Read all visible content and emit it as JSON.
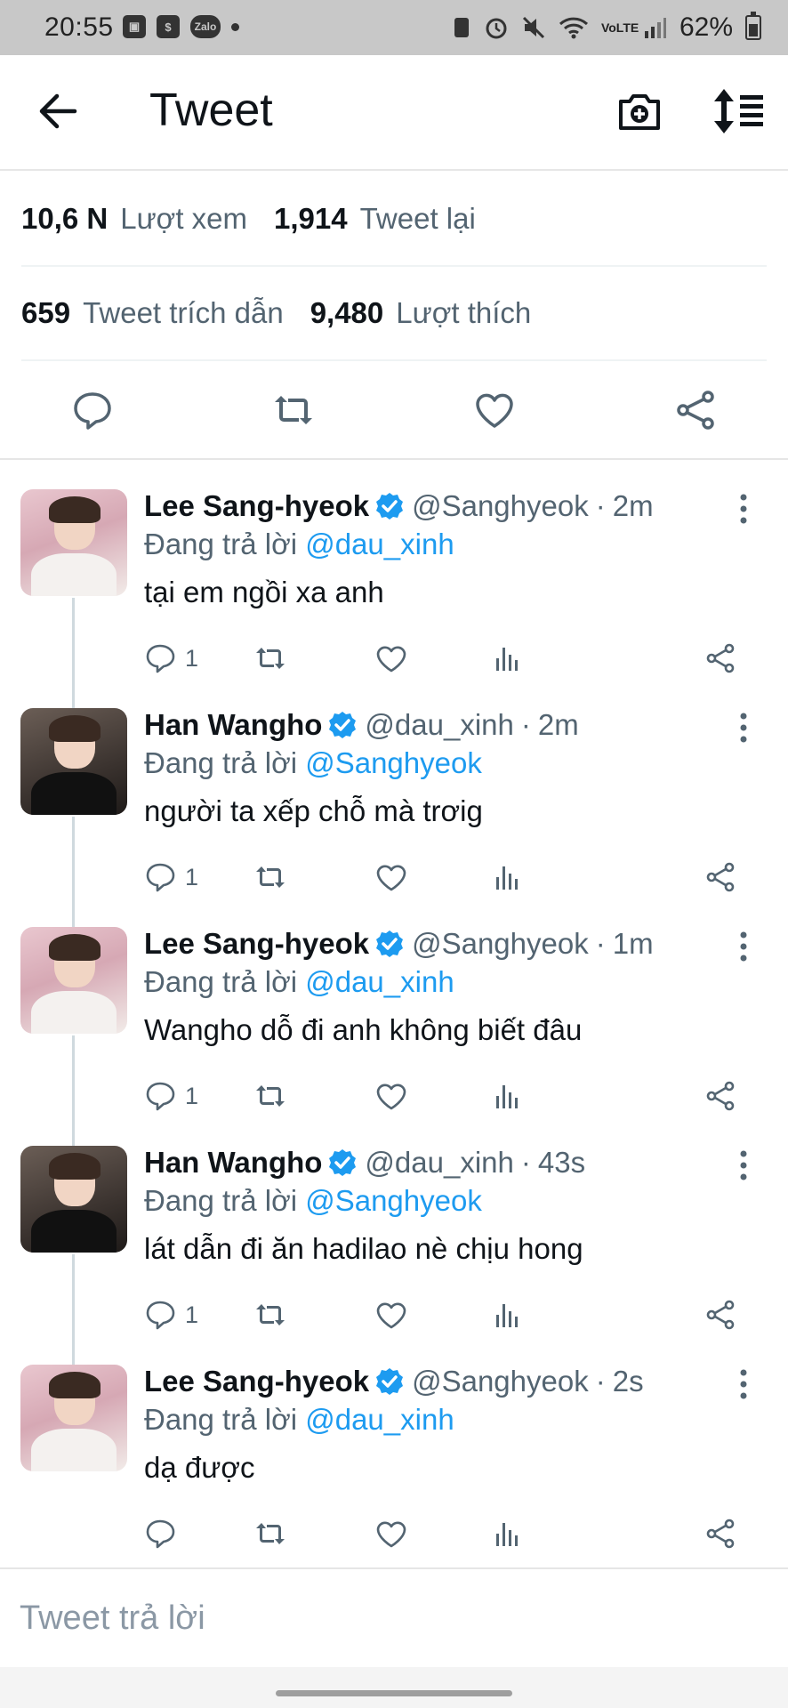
{
  "status_bar": {
    "time": "20:55",
    "left_icons": [
      "gallery-icon",
      "shop-icon",
      "zalo-icon",
      "dot-icon"
    ],
    "zalo_label": "Zalo",
    "network_label": "VoLTE",
    "battery": "62%"
  },
  "header": {
    "title": "Tweet"
  },
  "stats": {
    "views_count": "10,6 N",
    "views_label": "Lượt xem",
    "retweets_count": "1,914",
    "retweets_label": "Tweet lại",
    "quotes_count": "659",
    "quotes_label": "Tweet trích dẫn",
    "likes_count": "9,480",
    "likes_label": "Lượt thích"
  },
  "colors": {
    "accent": "#1d9bf0",
    "secondary_text": "#536471"
  },
  "replies": [
    {
      "avatar": "lee",
      "name": "Lee Sang-hyeok",
      "handle": "@Sanghyeok",
      "time": "2m",
      "replying_prefix": "Đang trả lời",
      "replying_to": "@dau_xinh",
      "text": "tại em ngồi xa anh",
      "reply_count": "1"
    },
    {
      "avatar": "han",
      "name": "Han Wangho",
      "handle": "@dau_xinh",
      "time": "2m",
      "replying_prefix": "Đang trả lời",
      "replying_to": "@Sanghyeok",
      "text": "người ta xếp chỗ mà trơig",
      "reply_count": "1"
    },
    {
      "avatar": "lee",
      "name": "Lee Sang-hyeok",
      "handle": "@Sanghyeok",
      "time": "1m",
      "replying_prefix": "Đang trả lời",
      "replying_to": "@dau_xinh",
      "text": "Wangho dỗ đi anh không biết đâu",
      "reply_count": "1"
    },
    {
      "avatar": "han",
      "name": "Han Wangho",
      "handle": "@dau_xinh",
      "time": "43s",
      "replying_prefix": "Đang trả lời",
      "replying_to": "@Sanghyeok",
      "text": "lát dẫn đi ăn hadilao nè chịu hong",
      "reply_count": "1"
    },
    {
      "avatar": "lee",
      "name": "Lee Sang-hyeok",
      "handle": "@Sanghyeok",
      "time": "2s",
      "replying_prefix": "Đang trả lời",
      "replying_to": "@dau_xinh",
      "text": "dạ được",
      "reply_count": ""
    }
  ],
  "composer": {
    "placeholder": "Tweet trả lời"
  }
}
